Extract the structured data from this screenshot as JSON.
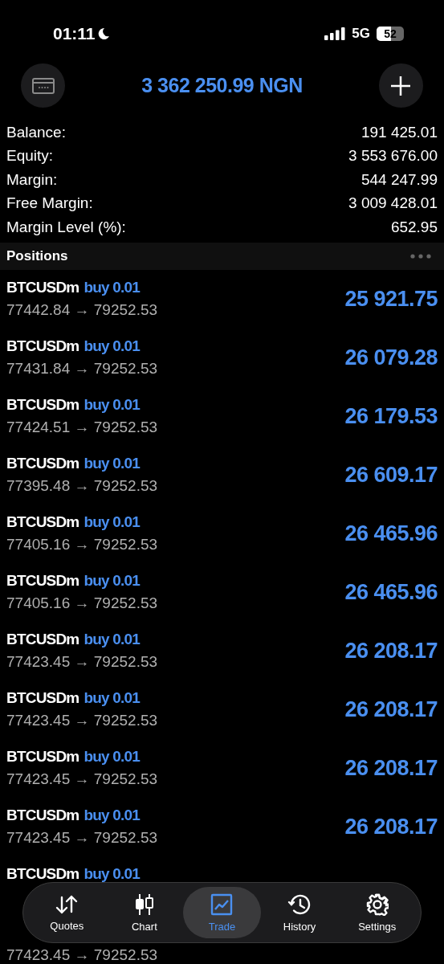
{
  "status_bar": {
    "time": "01:11",
    "network": "5G",
    "battery": {
      "text": "52",
      "level": 0.52
    }
  },
  "header": {
    "balance_title": "3 362 250.99 NGN"
  },
  "summary": [
    {
      "label": "Balance:",
      "value": "191 425.01"
    },
    {
      "label": "Equity:",
      "value": "3 553 676.00"
    },
    {
      "label": "Margin:",
      "value": "544 247.99"
    },
    {
      "label": "Free Margin:",
      "value": "3 009 428.01"
    },
    {
      "label": "Margin Level (%):",
      "value": "652.95"
    }
  ],
  "positions": {
    "title": "Positions",
    "rows": [
      {
        "symbol": "BTCUSDm",
        "side": "buy 0.01",
        "prices": "77442.84 → 79252.53",
        "profit": "25 921.75"
      },
      {
        "symbol": "BTCUSDm",
        "side": "buy 0.01",
        "prices": "77431.84 → 79252.53",
        "profit": "26 079.28"
      },
      {
        "symbol": "BTCUSDm",
        "side": "buy 0.01",
        "prices": "77424.51 → 79252.53",
        "profit": "26 179.53"
      },
      {
        "symbol": "BTCUSDm",
        "side": "buy 0.01",
        "prices": "77395.48 → 79252.53",
        "profit": "26 609.17"
      },
      {
        "symbol": "BTCUSDm",
        "side": "buy 0.01",
        "prices": "77405.16 → 79252.53",
        "profit": "26 465.96"
      },
      {
        "symbol": "BTCUSDm",
        "side": "buy 0.01",
        "prices": "77405.16 → 79252.53",
        "profit": "26 465.96"
      },
      {
        "symbol": "BTCUSDm",
        "side": "buy 0.01",
        "prices": "77423.45 → 79252.53",
        "profit": "26 208.17"
      },
      {
        "symbol": "BTCUSDm",
        "side": "buy 0.01",
        "prices": "77423.45 → 79252.53",
        "profit": "26 208.17"
      },
      {
        "symbol": "BTCUSDm",
        "side": "buy 0.01",
        "prices": "77423.45 → 79252.53",
        "profit": "26 208.17"
      },
      {
        "symbol": "BTCUSDm",
        "side": "buy 0.01",
        "prices": "77423.45 → 79252.53",
        "profit": "26 208.17"
      },
      {
        "symbol": "BTCUSDm",
        "side": "buy 0.01"
      },
      {
        "prices": "77423.45 → 79252.53"
      }
    ]
  },
  "tab_bar": [
    {
      "kind": "quotes",
      "label": "Quotes",
      "selected": false
    },
    {
      "kind": "chart",
      "label": "Chart",
      "selected": false
    },
    {
      "kind": "trade",
      "label": "Trade",
      "selected": true
    },
    {
      "kind": "history",
      "label": "History",
      "selected": false
    },
    {
      "kind": "settings",
      "label": "Settings",
      "selected": false
    }
  ]
}
